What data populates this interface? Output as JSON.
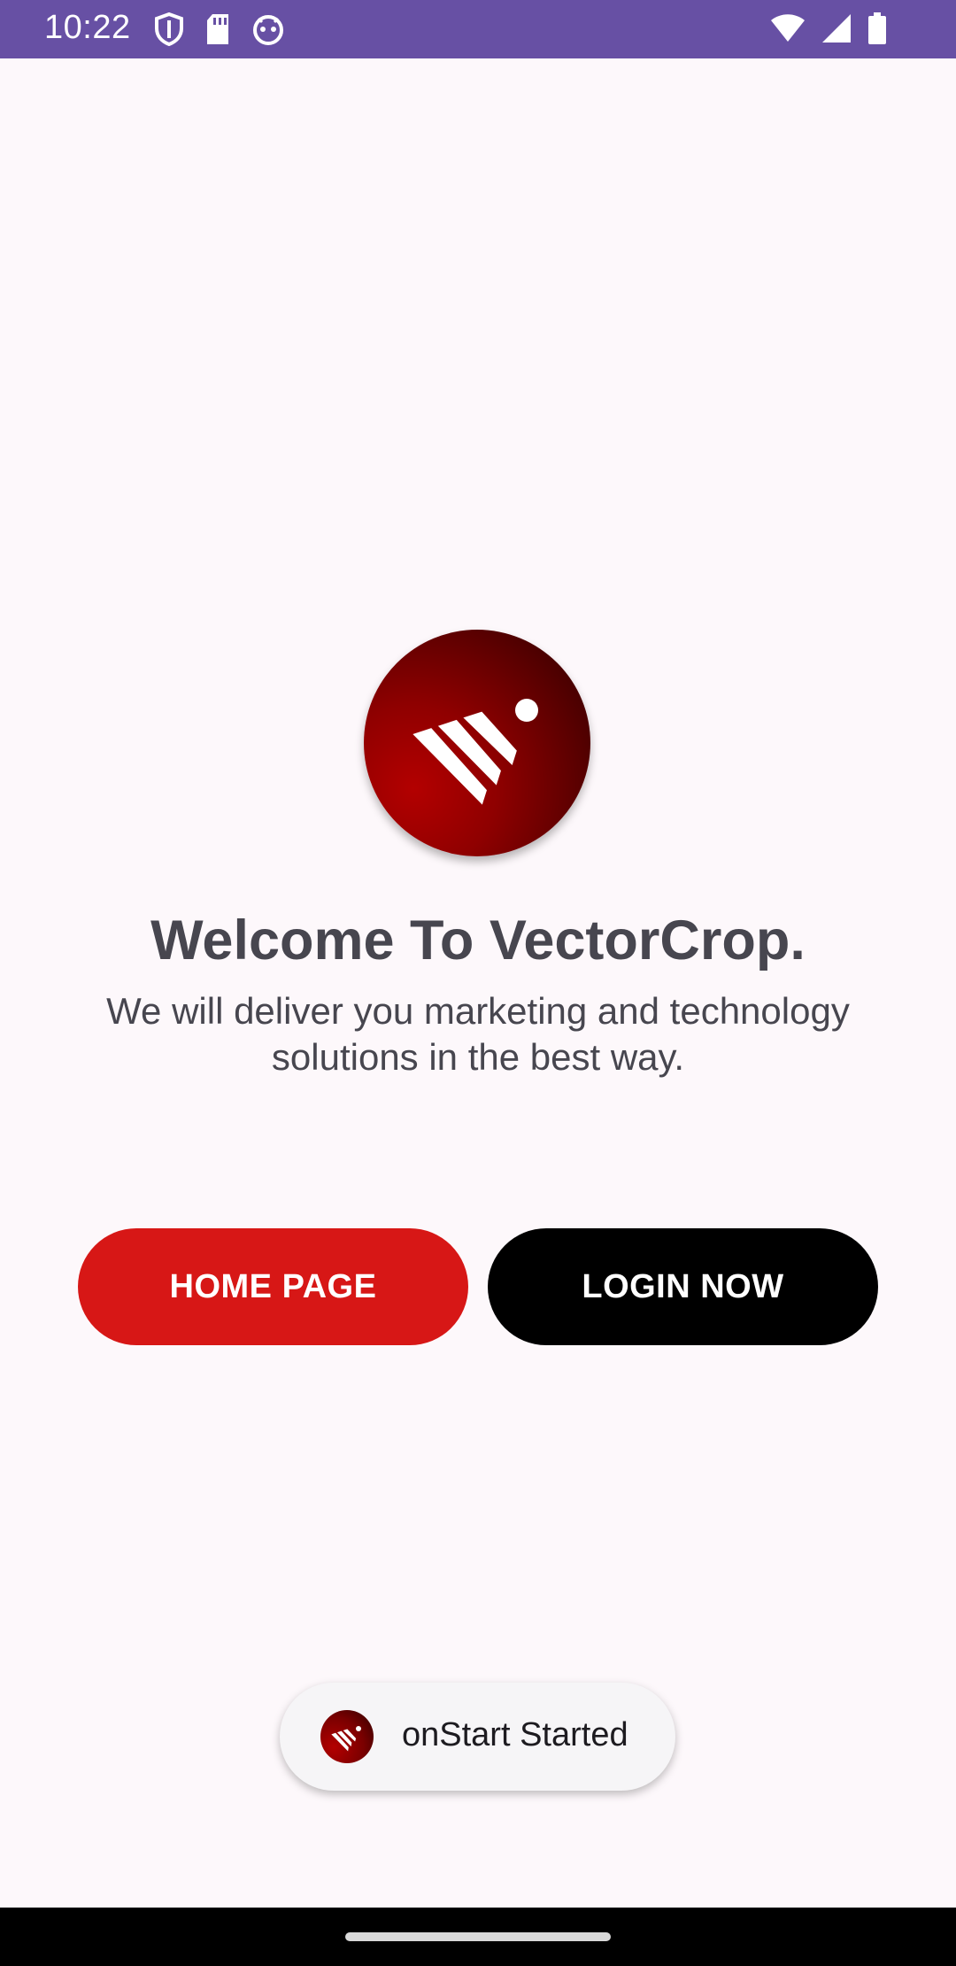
{
  "status_bar": {
    "time": "10:22",
    "left_icons": [
      "shield-icon",
      "sd-card-icon",
      "android-debug-icon"
    ],
    "right_icons": [
      "wifi-icon",
      "cell-signal-icon",
      "battery-icon"
    ],
    "background": "#6750a4"
  },
  "logo": {
    "icon": "vectorcrop-logo",
    "colors": [
      "#b30000",
      "#2c0000"
    ]
  },
  "welcome": {
    "title": "Welcome To VectorCrop.",
    "subtitle_line1": "We will deliver you marketing and technology",
    "subtitle_line2": "solutions in the best way."
  },
  "buttons": {
    "home_label": "HOME PAGE",
    "home_color": "#d71716",
    "login_label": "LOGIN NOW",
    "login_color": "#000000"
  },
  "toast": {
    "icon": "app-icon",
    "message": "onStart Started"
  },
  "nav_bar": {
    "handle": "home-gesture-handle"
  }
}
